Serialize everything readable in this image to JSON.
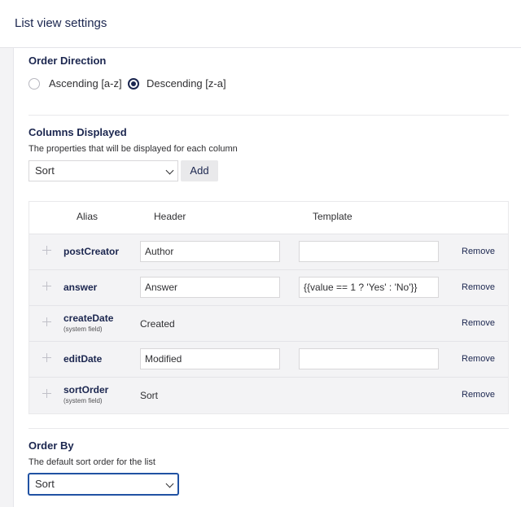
{
  "header": {
    "title": "List view settings"
  },
  "order_direction": {
    "label": "Order Direction",
    "options": [
      {
        "label": "Ascending [a-z]",
        "checked": false
      },
      {
        "label": "Descending [z-a]",
        "checked": true
      }
    ]
  },
  "columns_displayed": {
    "label": "Columns Displayed",
    "description": "The properties that will be displayed for each column",
    "select_value": "Sort",
    "add_label": "Add",
    "table": {
      "headers": {
        "alias": "Alias",
        "header": "Header",
        "template": "Template"
      },
      "rows": [
        {
          "alias": "postCreator",
          "system": "",
          "header": "Author",
          "template": "",
          "editable": true,
          "remove": "Remove"
        },
        {
          "alias": "answer",
          "system": "",
          "header": "Answer",
          "template": "{{value == 1 ? 'Yes' : 'No'}}",
          "editable": true,
          "remove": "Remove"
        },
        {
          "alias": "createDate",
          "system": "(system field)",
          "header": "Created",
          "template": "",
          "editable": false,
          "remove": "Remove"
        },
        {
          "alias": "editDate",
          "system": "",
          "header": "Modified",
          "template": "",
          "editable": true,
          "remove": "Remove"
        },
        {
          "alias": "sortOrder",
          "system": "(system field)",
          "header": "Sort",
          "template": "",
          "editable": false,
          "remove": "Remove"
        }
      ]
    }
  },
  "order_by": {
    "label": "Order By",
    "description": "The default sort order for the list",
    "select_value": "Sort"
  }
}
